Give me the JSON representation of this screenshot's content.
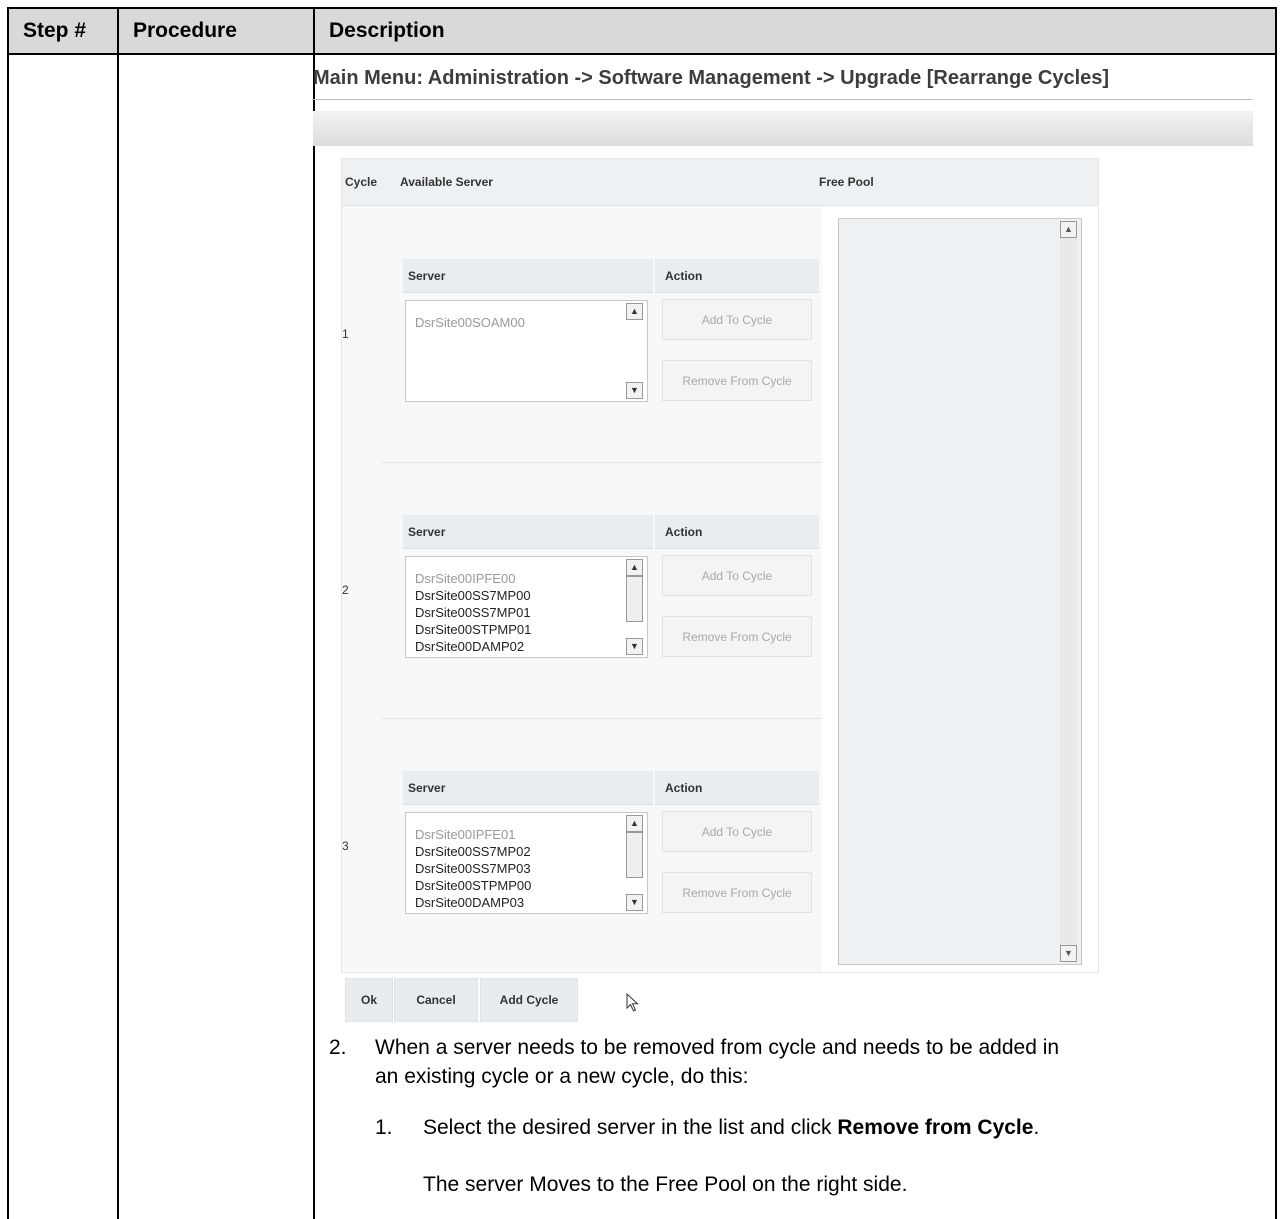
{
  "table": {
    "headers": [
      "Step #",
      "Procedure",
      "Description"
    ]
  },
  "screen": {
    "menu_title": "Main Menu: Administration -> Software Management -> Upgrade [Rearrange Cycles]",
    "columns": {
      "cycle": "Cycle",
      "available_server": "Available Server",
      "free_pool": "Free Pool"
    },
    "sub_columns": {
      "server": "Server",
      "action": "Action"
    },
    "action_labels": {
      "add": "Add To Cycle",
      "remove": "Remove From Cycle"
    },
    "cycles": [
      {
        "number": "1",
        "servers": [
          {
            "name": "DsrSite00SOAM00",
            "disabled": true
          }
        ]
      },
      {
        "number": "2",
        "servers": [
          {
            "name": "DsrSite00IPFE00",
            "disabled": true
          },
          {
            "name": "DsrSite00SS7MP00",
            "disabled": false
          },
          {
            "name": "DsrSite00SS7MP01",
            "disabled": false
          },
          {
            "name": "DsrSite00STPMP01",
            "disabled": false
          },
          {
            "name": "DsrSite00DAMP02",
            "disabled": false
          }
        ]
      },
      {
        "number": "3",
        "servers": [
          {
            "name": "DsrSite00IPFE01",
            "disabled": true
          },
          {
            "name": "DsrSite00SS7MP02",
            "disabled": false
          },
          {
            "name": "DsrSite00SS7MP03",
            "disabled": false
          },
          {
            "name": "DsrSite00STPMP00",
            "disabled": false
          },
          {
            "name": "DsrSite00DAMP03",
            "disabled": false
          }
        ]
      }
    ],
    "buttons": {
      "ok": "Ok",
      "cancel": "Cancel",
      "add_cycle": "Add Cycle"
    }
  },
  "instructions": {
    "step2_number": "2.",
    "step2_line1": "When a server needs to be removed from cycle and needs to be added in",
    "step2_line2": "an existing cycle or a new cycle, do this:",
    "sub1_number": "1.",
    "sub1_text_before": "Select the desired server in the list and click ",
    "sub1_bold": "Remove from Cycle",
    "sub1_text_after": ".",
    "sub1_note": "The server Moves to the Free Pool on the right side."
  }
}
